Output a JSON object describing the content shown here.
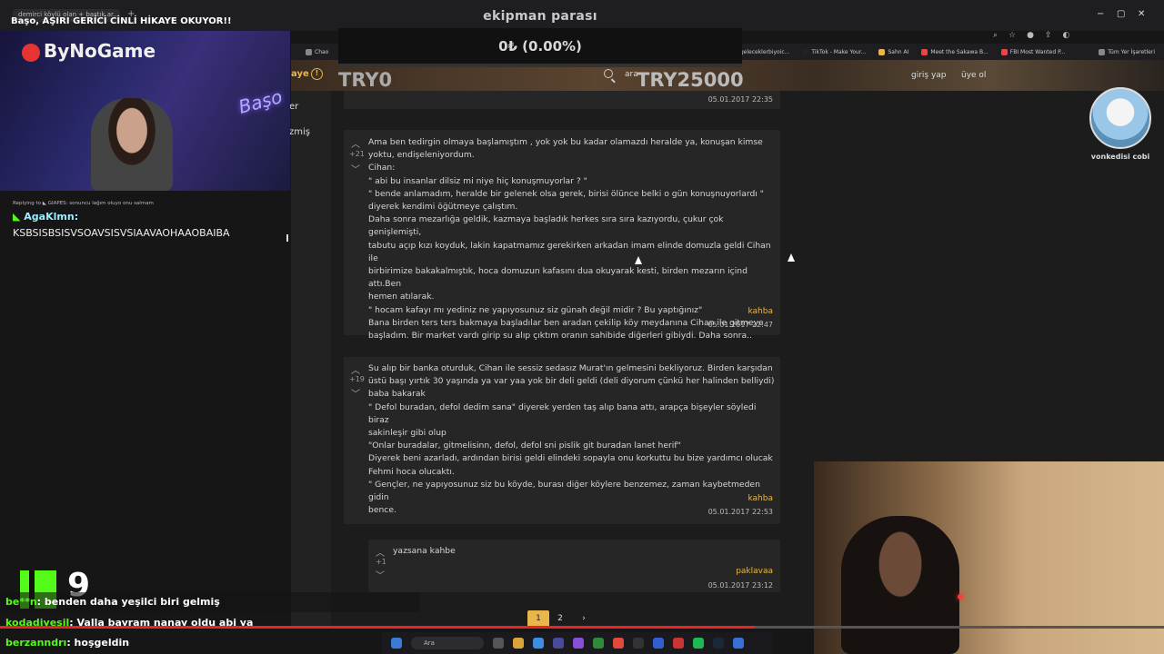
{
  "browser": {
    "tab_label": "demirci köylü olan + baştık ar...",
    "stream_title": "Başo, AŞIRI GERİCİ CİNLİ HİKAYE OKUYOR!!",
    "window_controls": [
      "−",
      "▢",
      "✕"
    ],
    "bookmarks": [
      "Chao",
      "(1)geleceklerbiyoic...",
      "TikTok - Make Your...",
      "Sahn AI",
      "Meet the Sakawa B...",
      "FBI Most Wanted P...",
      "Tüm Yer İşaretleri"
    ]
  },
  "donation_goal": {
    "title": "ekipman parası",
    "current": "0₺ (0.00%)",
    "min": "TRY0",
    "max": "TRY25000",
    "progress": 0.0
  },
  "site": {
    "nav_left": "aye",
    "search_label": "ara",
    "login": "giriş yap",
    "signup": "üye ol",
    "side_items": [
      "er",
      "zmiş"
    ]
  },
  "posts": [
    {
      "timestamp": "05.01.2017 22:35"
    },
    {
      "votes": "+21",
      "lines": [
        "Ama ben tedirgin olmaya başlamıştım , yok yok bu kadar olamazdı heralde ya, konuşan kimse",
        "yoktu, endişeleniyordum.",
        "Cihan:",
        "\" abi bu insanlar dilsiz mi niye hiç konuşmuyorlar ? \"",
        "\" bende anlamadım, heralde bir gelenek olsa gerek, birisi ölünce belki o gün konuşnuyorlardı \"",
        "diyerek kendimi öğütmeye çalıştım.",
        "Daha sonra mezarlığa geldik, kazmaya başladık herkes sıra sıra kazıyordu, çukur çok genişlemişti,",
        "tabutu açıp kızı koyduk, lakin kapatmamız gerekirken arkadan imam elinde domuzla geldi Cihan ile",
        "birbirimize bakakalmıştık, hoca domuzun kafasını dua okuyarak kesti, birden mezarın içind attı.Ben",
        "hemen atılarak.",
        "\" hocam kafayı mı yediniz ne yapıyosunuz siz günah değil midir ? Bu yaptığınız\"",
        "Bana birden ters ters bakmaya başladılar ben aradan çekilip köy meydanına Cihan ile gitmeye",
        "başladım. Bir market vardı girip su alıp çıktım oranın sahibide diğerleri gibiydi. Daha sonra.."
      ],
      "author": "kahba",
      "timestamp": "05.01.2017 22:47"
    },
    {
      "votes": "+19",
      "lines": [
        "Su alıp bir banka oturduk, Cihan ile sessiz sedasız Murat'ın gelmesini bekliyoruz. Birden karşıdan",
        "üstü başı yırtık 30 yaşında ya var yaa yok bir deli geldi (deli diyorum çünkü her halinden belliydi)",
        "baba bakarak",
        "\" Defol buradan, defol dedim sana\" diyerek yerden taş alıp bana attı, arapça bişeyler söyledi biraz",
        "sakinleşir gibi olup",
        "\"Onlar buradalar, gitmelisinn, defol, defol sni pislik git buradan lanet herif\"",
        "Diyerek beni azarladı, ardından birisi geldi elindeki sopayla onu korkuttu bu bize yardımcı olucak",
        "Fehmi hoca olucaktı.",
        "\" Gençler, ne yapıyosunuz siz bu köyde, burası diğer köylere benzemez, zaman kaybetmeden gidin",
        "bence."
      ],
      "author": "kahba",
      "timestamp": "05.01.2017 22:53"
    },
    {
      "votes": "+1",
      "lines": [
        "yazsana kahbe"
      ],
      "author": "paklavaa",
      "timestamp": "05.01.2017 23:12"
    }
  ],
  "pagination": {
    "pages": [
      "1",
      "2"
    ],
    "next": "›",
    "current": "1"
  },
  "profile": {
    "caption": "vonkedisi cobi"
  },
  "webcam_left": {
    "brand": "ByNoGame",
    "neon": "Başo"
  },
  "chat": {
    "reply_line": "Replying to ◣ GIAPES: sonuncu lağım oluyo onu salmam",
    "user": "AgaKlmn:",
    "message": "KSBSISBSISVSOAVSISVSIAAVAOHAAOBAIBA"
  },
  "kick_counter": {
    "value": "9"
  },
  "feed": [
    {
      "user": "be**n",
      "text": ": benden daha yeşilci biri gelmiş"
    },
    {
      "user": "kodadiyesil",
      "text": ": Valla bayram nanay oldu abi ya"
    },
    {
      "user": "berzanndrı",
      "text": ": hoşgeldin"
    }
  ],
  "taskbar": {
    "search": "Ara"
  }
}
